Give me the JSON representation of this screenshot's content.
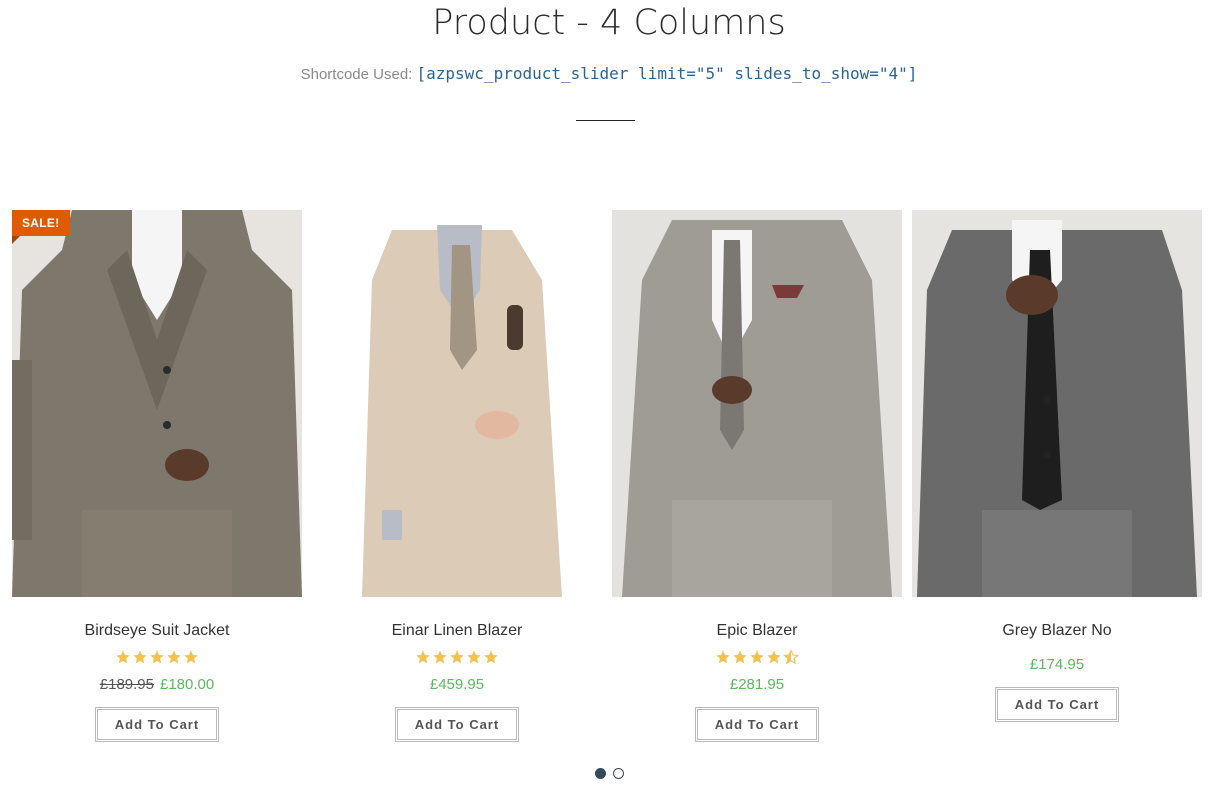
{
  "header": {
    "title": "Product - 4 Columns",
    "shortcode_label": "Shortcode Used:",
    "shortcode_value": "[azpswc_product_slider limit=\"5\" slides_to_show=\"4\"]"
  },
  "products": [
    {
      "name": "Birdseye Suit Jacket",
      "badge": "SALE!",
      "rating": 5,
      "old_price": "£189.95",
      "price": "£180.00",
      "button": "Add To Cart"
    },
    {
      "name": "Einar Linen Blazer",
      "rating": 5,
      "price": "£459.95",
      "button": "Add To Cart"
    },
    {
      "name": "Epic Blazer",
      "rating": 4.5,
      "price": "£281.95",
      "button": "Add To Cart"
    },
    {
      "name": "Grey Blazer No",
      "price": "£174.95",
      "button": "Add To Cart"
    }
  ],
  "pager": {
    "pages": 2,
    "current": 1
  },
  "colors": {
    "sale_badge": "#e05a00",
    "price": "#5cb85c",
    "star": "#f2c14e",
    "pager_dot": "#34495e"
  }
}
